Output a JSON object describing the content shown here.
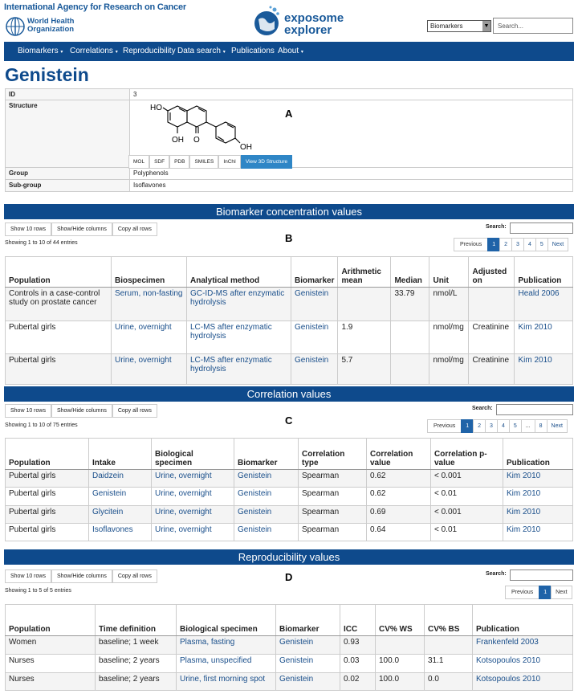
{
  "header": {
    "iarc_title": "International Agency for Research on Cancer",
    "who_line1": "World Health",
    "who_line2": "Organization",
    "logo_line1": "exposome",
    "logo_line2": "explorer",
    "select_value": "Biomarkers",
    "search_placeholder": "Search..."
  },
  "nav": [
    "Biomarkers",
    "Correlations",
    "Reproducibility",
    "Data search",
    "Publications",
    "About"
  ],
  "page_title": "Genistein",
  "info": {
    "id_label": "ID",
    "id_value": "3",
    "structure_label": "Structure",
    "group_label": "Group",
    "group_value": "Polyphenols",
    "subgroup_label": "Sub-group",
    "subgroup_value": "Isoflavones",
    "struct_buttons": [
      "MOL",
      "SDF",
      "PDB",
      "SMILES",
      "InChI",
      "View 3D Structure"
    ],
    "struct_oh1": "HO",
    "struct_oh2": "OH",
    "struct_oh3": "OH",
    "struct_o": "O"
  },
  "letters": {
    "a": "A",
    "b": "B",
    "c": "C",
    "d": "D"
  },
  "tools": {
    "show_rows": "Show 10 rows",
    "show_hide": "Show/Hide columns",
    "copy": "Copy all rows"
  },
  "search_label": "Search:",
  "concentration": {
    "title": "Biomarker concentration values",
    "entries": "Showing 1 to 10 of 44 entries",
    "pager": [
      "Previous",
      "1",
      "2",
      "3",
      "4",
      "5",
      "Next"
    ],
    "headers": [
      "Population",
      "Biospecimen",
      "Analytical method",
      "Biomarker",
      "Arithmetic mean",
      "Median",
      "Unit",
      "Adjusted on",
      "Publication"
    ],
    "rows": [
      [
        "Controls in a case-control study on prostate cancer",
        "Serum, non-fasting",
        "GC-ID-MS after enzymatic hydrolysis",
        "Genistein",
        "",
        "33.79",
        "nmol/L",
        "",
        "Heald 2006"
      ],
      [
        "Pubertal girls",
        "Urine, overnight",
        "LC-MS after enzymatic hydrolysis",
        "Genistein",
        "1.9",
        "",
        "nmol/mg",
        "Creatinine",
        "Kim 2010"
      ],
      [
        "Pubertal girls",
        "Urine, overnight",
        "LC-MS after enzymatic hydrolysis",
        "Genistein",
        "5.7",
        "",
        "nmol/mg",
        "Creatinine",
        "Kim 2010"
      ]
    ]
  },
  "correlation": {
    "title": "Correlation values",
    "entries": "Showing 1 to 10 of 75 entries",
    "pager": [
      "Previous",
      "1",
      "2",
      "3",
      "4",
      "5",
      "...",
      "8",
      "Next"
    ],
    "headers": [
      "Population",
      "Intake",
      "Biological specimen",
      "Biomarker",
      "Correlation type",
      "Correlation value",
      "Correlation p-value",
      "Publication"
    ],
    "rows": [
      [
        "Pubertal girls",
        "Daidzein",
        "Urine, overnight",
        "Genistein",
        "Spearman",
        "0.62",
        "< 0.001",
        "Kim 2010"
      ],
      [
        "Pubertal girls",
        "Genistein",
        "Urine, overnight",
        "Genistein",
        "Spearman",
        "0.62",
        "< 0.01",
        "Kim 2010"
      ],
      [
        "Pubertal girls",
        "Glycitein",
        "Urine, overnight",
        "Genistein",
        "Spearman",
        "0.69",
        "< 0.001",
        "Kim 2010"
      ],
      [
        "Pubertal girls",
        "Isoflavones",
        "Urine, overnight",
        "Genistein",
        "Spearman",
        "0.64",
        "< 0.01",
        "Kim 2010"
      ]
    ]
  },
  "reproducibility": {
    "title": "Reproducibility values",
    "entries": "Showing 1 to 5 of 5 entries",
    "pager": [
      "Previous",
      "1",
      "Next"
    ],
    "headers": [
      "Population",
      "Time definition",
      "Biological specimen",
      "Biomarker",
      "ICC",
      "CV% WS",
      "CV% BS",
      "Publication"
    ],
    "rows": [
      [
        "Women",
        "baseline; 1 week",
        "Plasma, fasting",
        "Genistein",
        "0.93",
        "",
        "",
        "Frankenfeld 2003"
      ],
      [
        "Nurses",
        "baseline; 2 years",
        "Plasma, unspecified",
        "Genistein",
        "0.03",
        "100.0",
        "31.1",
        "Kotsopoulos 2010"
      ],
      [
        "Nurses",
        "baseline; 2 years",
        "Urine, first morning spot",
        "Genistein",
        "0.02",
        "100.0",
        "0.0",
        "Kotsopoulos 2010"
      ]
    ]
  }
}
